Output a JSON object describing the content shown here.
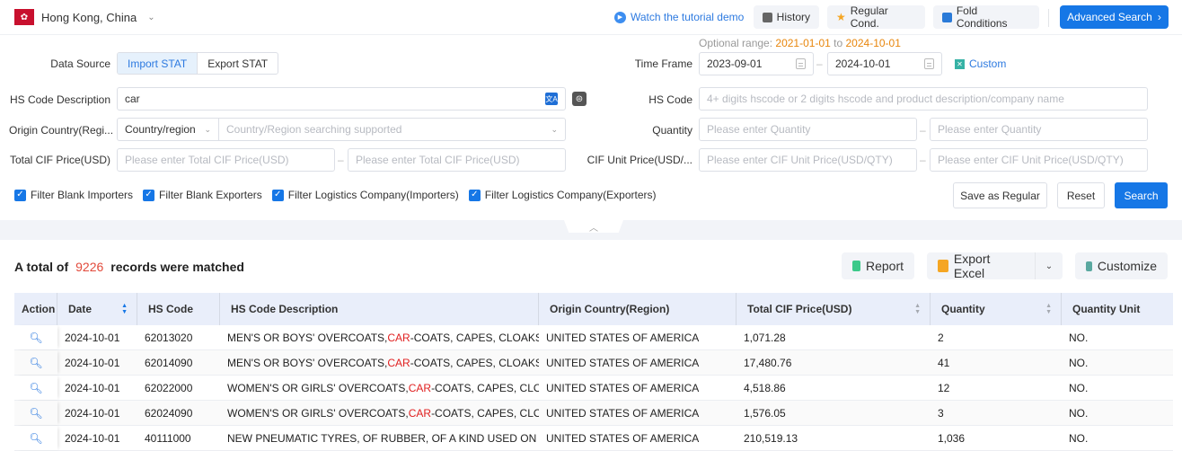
{
  "topbar": {
    "region": "Hong Kong, China",
    "region_flag": "hk-flag-icon",
    "tutorial_link": "Watch the tutorial demo",
    "history": "History",
    "regular_cond": "Regular Cond.",
    "fold_conditions": "Fold Conditions",
    "advanced_search": "Advanced Search"
  },
  "form": {
    "data_source_label": "Data Source",
    "data_source_options": [
      "Import STAT",
      "Export STAT"
    ],
    "data_source_selected": "Import STAT",
    "optional_range_label": "Optional range:",
    "optional_range_start": "2021-01-01",
    "optional_range_to": "to",
    "optional_range_end": "2024-10-01",
    "time_frame_label": "Time Frame",
    "time_start": "2023-09-01",
    "time_end": "2024-10-01",
    "custom": "Custom",
    "hs_desc_label": "HS Code Description",
    "hs_desc_value": "car",
    "hs_code_label": "HS Code",
    "hs_code_placeholder": "4+ digits hscode or 2 digits hscode and product description/company name",
    "origin_label": "Origin Country(Regi...",
    "origin_type": "Country/region",
    "origin_placeholder": "Country/Region searching supported",
    "quantity_label": "Quantity",
    "quantity_min_placeholder": "Please enter Quantity",
    "quantity_max_placeholder": "Please enter Quantity",
    "cif_total_label": "Total CIF Price(USD)",
    "cif_total_min_placeholder": "Please enter Total CIF Price(USD)",
    "cif_total_max_placeholder": "Please enter Total CIF Price(USD)",
    "cif_unit_label": "CIF Unit Price(USD/...",
    "cif_unit_min_placeholder": "Please enter CIF Unit Price(USD/QTY)",
    "cif_unit_max_placeholder": "Please enter CIF Unit Price(USD/QTY)",
    "filters": [
      {
        "label": "Filter Blank Importers",
        "checked": true
      },
      {
        "label": "Filter Blank Exporters",
        "checked": true
      },
      {
        "label": "Filter Logistics Company(Importers)",
        "checked": true
      },
      {
        "label": "Filter Logistics Company(Exporters)",
        "checked": true
      }
    ],
    "save_regular": "Save as Regular",
    "reset": "Reset",
    "search": "Search"
  },
  "results": {
    "total_prefix": "A total of",
    "total_count": "9226",
    "total_suffix": "records were matched",
    "report": "Report",
    "export_excel": "Export Excel",
    "customize": "Customize"
  },
  "table": {
    "columns": [
      "Action",
      "Date",
      "HS Code",
      "HS Code Description",
      "Origin Country(Region)",
      "Total CIF Price(USD)",
      "Quantity",
      "Quantity Unit"
    ],
    "highlight_term": "CAR",
    "rows": [
      {
        "date": "2024-10-01",
        "hs_code": "62013020",
        "desc_pre": "MEN'S OR BOYS' OVERCOATS, ",
        "desc_hl": "CAR",
        "desc_post": "-COATS, CAPES, CLOAKS, ANO...",
        "origin": "UNITED STATES OF AMERICA",
        "cif": "1,071.28",
        "qty": "2",
        "unit": "NO."
      },
      {
        "date": "2024-10-01",
        "hs_code": "62014090",
        "desc_pre": "MEN'S OR BOYS' OVERCOATS, ",
        "desc_hl": "CAR",
        "desc_post": "-COATS, CAPES, CLOAKS, ANO...",
        "origin": "UNITED STATES OF AMERICA",
        "cif": "17,480.76",
        "qty": "41",
        "unit": "NO."
      },
      {
        "date": "2024-10-01",
        "hs_code": "62022000",
        "desc_pre": "WOMEN'S OR GIRLS' OVERCOATS, ",
        "desc_hl": "CAR",
        "desc_post": "-COATS, CAPES, CLOAKS, ...",
        "origin": "UNITED STATES OF AMERICA",
        "cif": "4,518.86",
        "qty": "12",
        "unit": "NO."
      },
      {
        "date": "2024-10-01",
        "hs_code": "62024090",
        "desc_pre": "WOMEN'S OR GIRLS' OVERCOATS, ",
        "desc_hl": "CAR",
        "desc_post": "-COATS, CAPES, CLOAKS, ...",
        "origin": "UNITED STATES OF AMERICA",
        "cif": "1,576.05",
        "qty": "3",
        "unit": "NO."
      },
      {
        "date": "2024-10-01",
        "hs_code": "40111000",
        "desc_pre": "NEW PNEUMATIC TYRES, OF RUBBER, OF A KIND USED ON MOTO...",
        "desc_hl": "",
        "desc_post": "",
        "origin": "UNITED STATES OF AMERICA",
        "cif": "210,519.13",
        "qty": "1,036",
        "unit": "NO."
      }
    ]
  }
}
